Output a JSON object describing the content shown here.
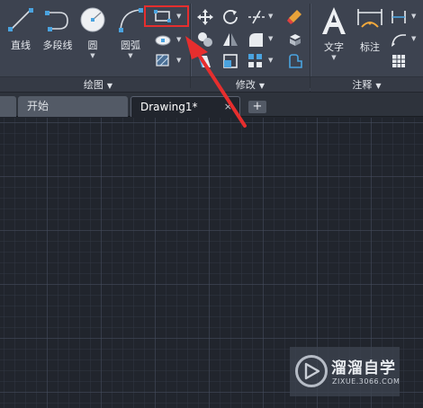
{
  "ribbon": {
    "draw_panel": {
      "title": "绘图",
      "tools": [
        {
          "label": "直线",
          "icon": "line-icon"
        },
        {
          "label": "多段线",
          "icon": "polyline-icon"
        },
        {
          "label": "圆",
          "icon": "circle-icon"
        },
        {
          "label": "圆弧",
          "icon": "arc-icon"
        }
      ],
      "small_tools": [
        "rectangle-icon",
        "ellipse-icon",
        "hatch-icon"
      ]
    },
    "modify_panel": {
      "title": "修改",
      "small_tools": [
        "move-icon",
        "rotate-icon",
        "trim-icon",
        "erase-icon",
        "copy-icon",
        "mirror-icon",
        "fillet-icon",
        "explode-icon",
        "stretch-icon",
        "scale-icon",
        "array-icon",
        "offset-icon"
      ]
    },
    "annotation_panel": {
      "title": "注释",
      "tools": [
        {
          "label": "文字",
          "icon": "text-icon"
        },
        {
          "label": "标注",
          "icon": "dimension-icon"
        }
      ],
      "small_tools": [
        "linear-dimension-icon",
        "leader-icon",
        "table-icon"
      ]
    }
  },
  "tabs": [
    {
      "label": "开始",
      "active": false
    },
    {
      "label": "Drawing1*",
      "active": true,
      "close": "×"
    }
  ],
  "new_tab": "+",
  "colors": {
    "highlight": "#e62e2e",
    "canvas": "#21252d",
    "ribbon": "#3d4350"
  },
  "watermark": {
    "main": "溜溜自学",
    "sub": "ZIXUE.3066.COM"
  }
}
